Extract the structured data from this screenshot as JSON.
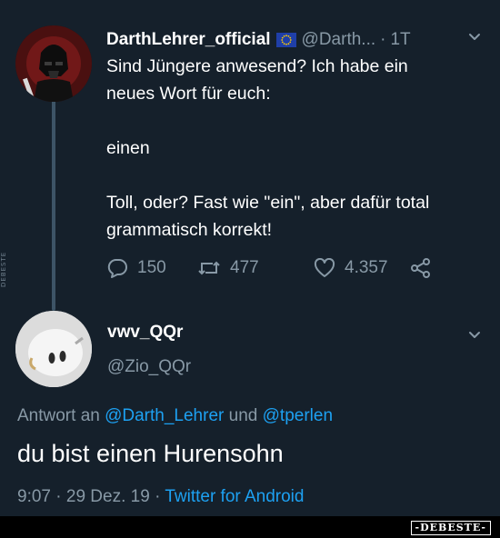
{
  "tweet": {
    "author_name": "DarthLehrer_official",
    "author_handle": "@Darth...",
    "separator": "·",
    "time": "1T",
    "text": "Sind Jüngere anwesend? Ich habe ein\nneues Wort für euch:\n\neinen\n\nToll, oder? Fast wie \"ein\", aber dafür total\ngrammatisch korrekt!",
    "replies": "150",
    "retweets": "477",
    "likes": "4.357"
  },
  "reply": {
    "author_name": "vwv_QQr",
    "author_handle": "@Zio_QQr",
    "reply_prefix": "Antwort an",
    "mention_1": "@Darth_Lehrer",
    "conjunction": "und",
    "mention_2": "@tperlen",
    "text": "du bist einen Hurensohn",
    "time": "9:07",
    "date": "29 Dez. 19",
    "separator": "·",
    "source": "Twitter for Android"
  },
  "icons": {
    "verified_flag": "eu-flag-icon",
    "more": "chevron-down-icon",
    "reply": "reply-icon",
    "retweet": "retweet-icon",
    "like": "heart-icon",
    "share": "share-icon"
  },
  "colors": {
    "background": "#15202b",
    "muted": "#8899a6",
    "link": "#1da1f2"
  },
  "watermarks": {
    "bottom": "-DEBESTE-",
    "side": "DEBESTE"
  }
}
